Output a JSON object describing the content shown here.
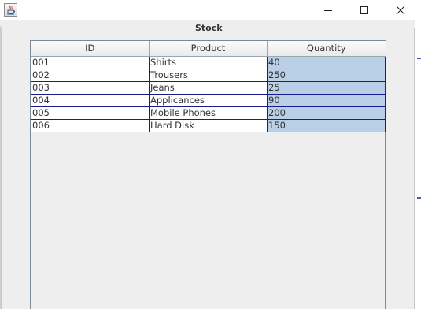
{
  "window": {
    "app_icon": "java-coffee-cup-icon",
    "controls": [
      "minimize-icon",
      "maximize-icon",
      "close-icon"
    ]
  },
  "panel": {
    "title": "Stock"
  },
  "table": {
    "columns": [
      "ID",
      "Product",
      "Quantity"
    ],
    "rows": [
      {
        "id": "001",
        "product": "Shirts",
        "quantity": "40"
      },
      {
        "id": "002",
        "product": "Trousers",
        "quantity": "250"
      },
      {
        "id": "003",
        "product": "Jeans",
        "quantity": "25"
      },
      {
        "id": "004",
        "product": "Applicances",
        "quantity": "90"
      },
      {
        "id": "005",
        "product": "Mobile Phones",
        "quantity": "200"
      },
      {
        "id": "006",
        "product": "Hard Disk",
        "quantity": "150"
      }
    ],
    "selected_column": "Quantity"
  },
  "colors": {
    "selection": "#b8cfe5",
    "grid_line": "#1a1a8f",
    "panel_background": "#eeeeee"
  }
}
